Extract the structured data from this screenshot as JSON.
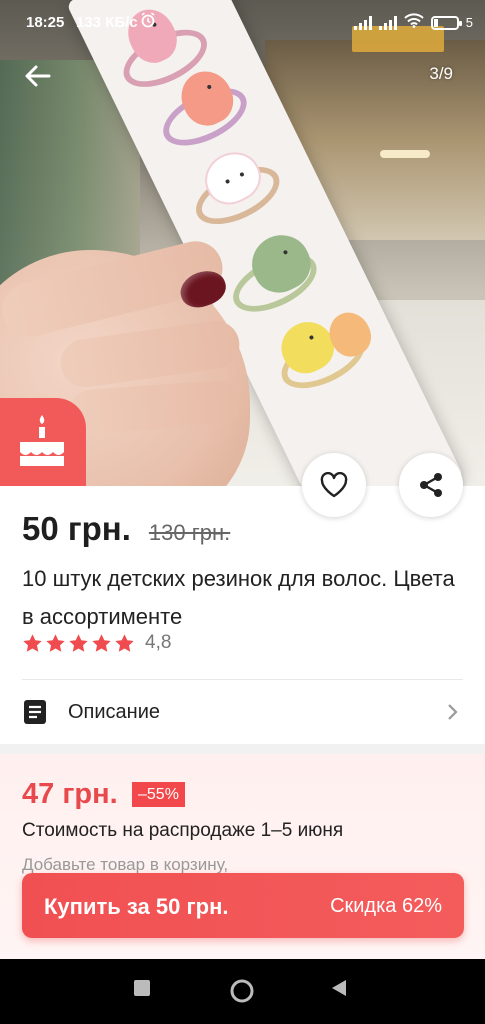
{
  "status_bar": {
    "time": "18:25",
    "speed": "133 КБ/с",
    "battery": "5"
  },
  "gallery": {
    "counter": "3/9"
  },
  "product": {
    "price": "50 грн.",
    "old_price": "130 грн.",
    "title": "10 штук детских резинок для волос. Цвета в ассортименте",
    "rating": "4,8",
    "rating_stars": 5
  },
  "description": {
    "label": "Описание"
  },
  "sale": {
    "price": "47 грн.",
    "discount": "–55%",
    "period": "Стоимость на распродаже 1–5 июня",
    "hint": "Добавьте товар в корзину,"
  },
  "buy_bar": {
    "label": "Купить за 50 грн.",
    "discount": "Скидка 62%"
  },
  "colors": {
    "accent": "#f25a5a",
    "sale_text": "#e8494c",
    "star": "#f04b4f"
  },
  "icons": {
    "back": "arrow-left-icon",
    "promo": "birthday-cake-icon",
    "wishlist": "heart-icon",
    "share": "share-icon",
    "description": "document-icon",
    "chevron": "chevron-right-icon",
    "nav_recent": "square-icon",
    "nav_home": "circle-icon",
    "nav_back": "triangle-back-icon"
  }
}
